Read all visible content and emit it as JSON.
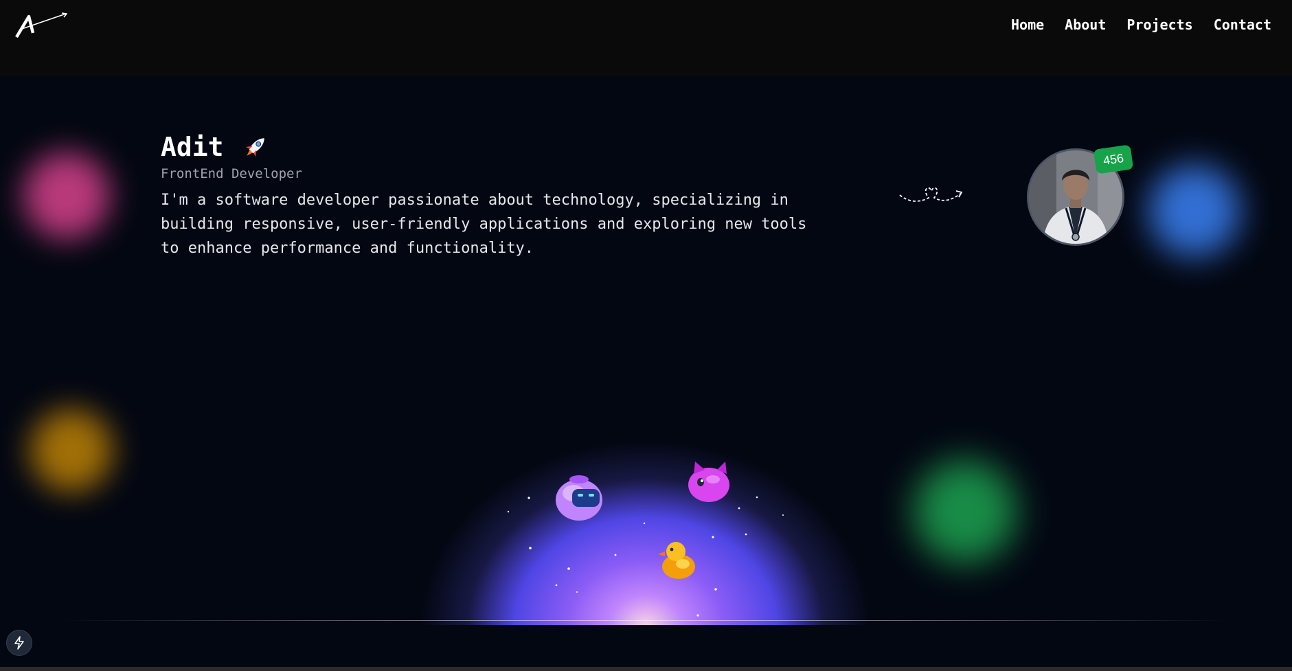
{
  "nav": {
    "items": [
      "Home",
      "About",
      "Projects",
      "Contact"
    ]
  },
  "hero": {
    "name": "Adit",
    "role": "FrontEnd Developer",
    "bio": "I'm a software developer passionate about technology, specializing in building responsive, user-friendly applications and exploring new tools to enhance performance and functionality."
  },
  "profile": {
    "badge": "456"
  },
  "icons": [
    "logo-icon",
    "rocket-icon",
    "heart-doodle-icon",
    "lightning-icon",
    "robot-toy-icon",
    "pink-creature-toy-icon",
    "duck-toy-icon"
  ],
  "colors": {
    "background": "#030712",
    "topbar": "#0a0a0a",
    "badge": "#16a34a",
    "blob_pink": "#ec4899",
    "blob_yellow": "#ca8a04",
    "blob_blue": "#3b82f6",
    "blob_green": "#22c55e"
  }
}
